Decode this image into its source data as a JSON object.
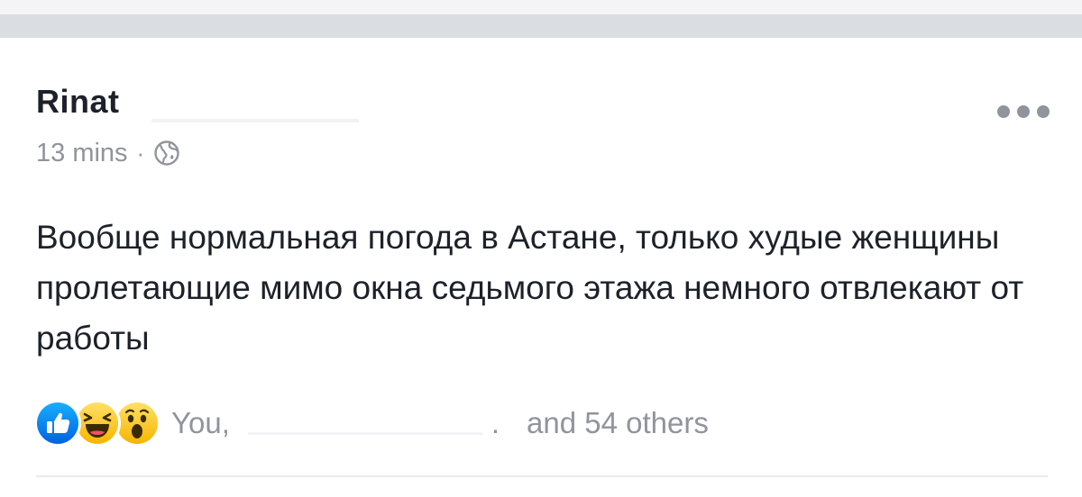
{
  "post": {
    "author": "Rinat",
    "timestamp": "13 mins",
    "separator": "·",
    "privacy_icon": "globe-icon",
    "more_icon": "more-options-icon",
    "text": "Вообще нормальная погода в Астане, только худые женщины пролетающие мимо окна седьмого этажа немного отвлекают от работы"
  },
  "reactions": {
    "icons": [
      "like-icon",
      "haha-icon",
      "wow-icon"
    ],
    "you_label": "You,",
    "dot": ".",
    "others_label": "and 54 others"
  },
  "colors": {
    "text_primary": "#1d2129",
    "text_secondary": "#90949c",
    "like_blue": "#4080ff",
    "emoji_yellow": "#ffd43b",
    "top_bar": "#dadde1"
  }
}
